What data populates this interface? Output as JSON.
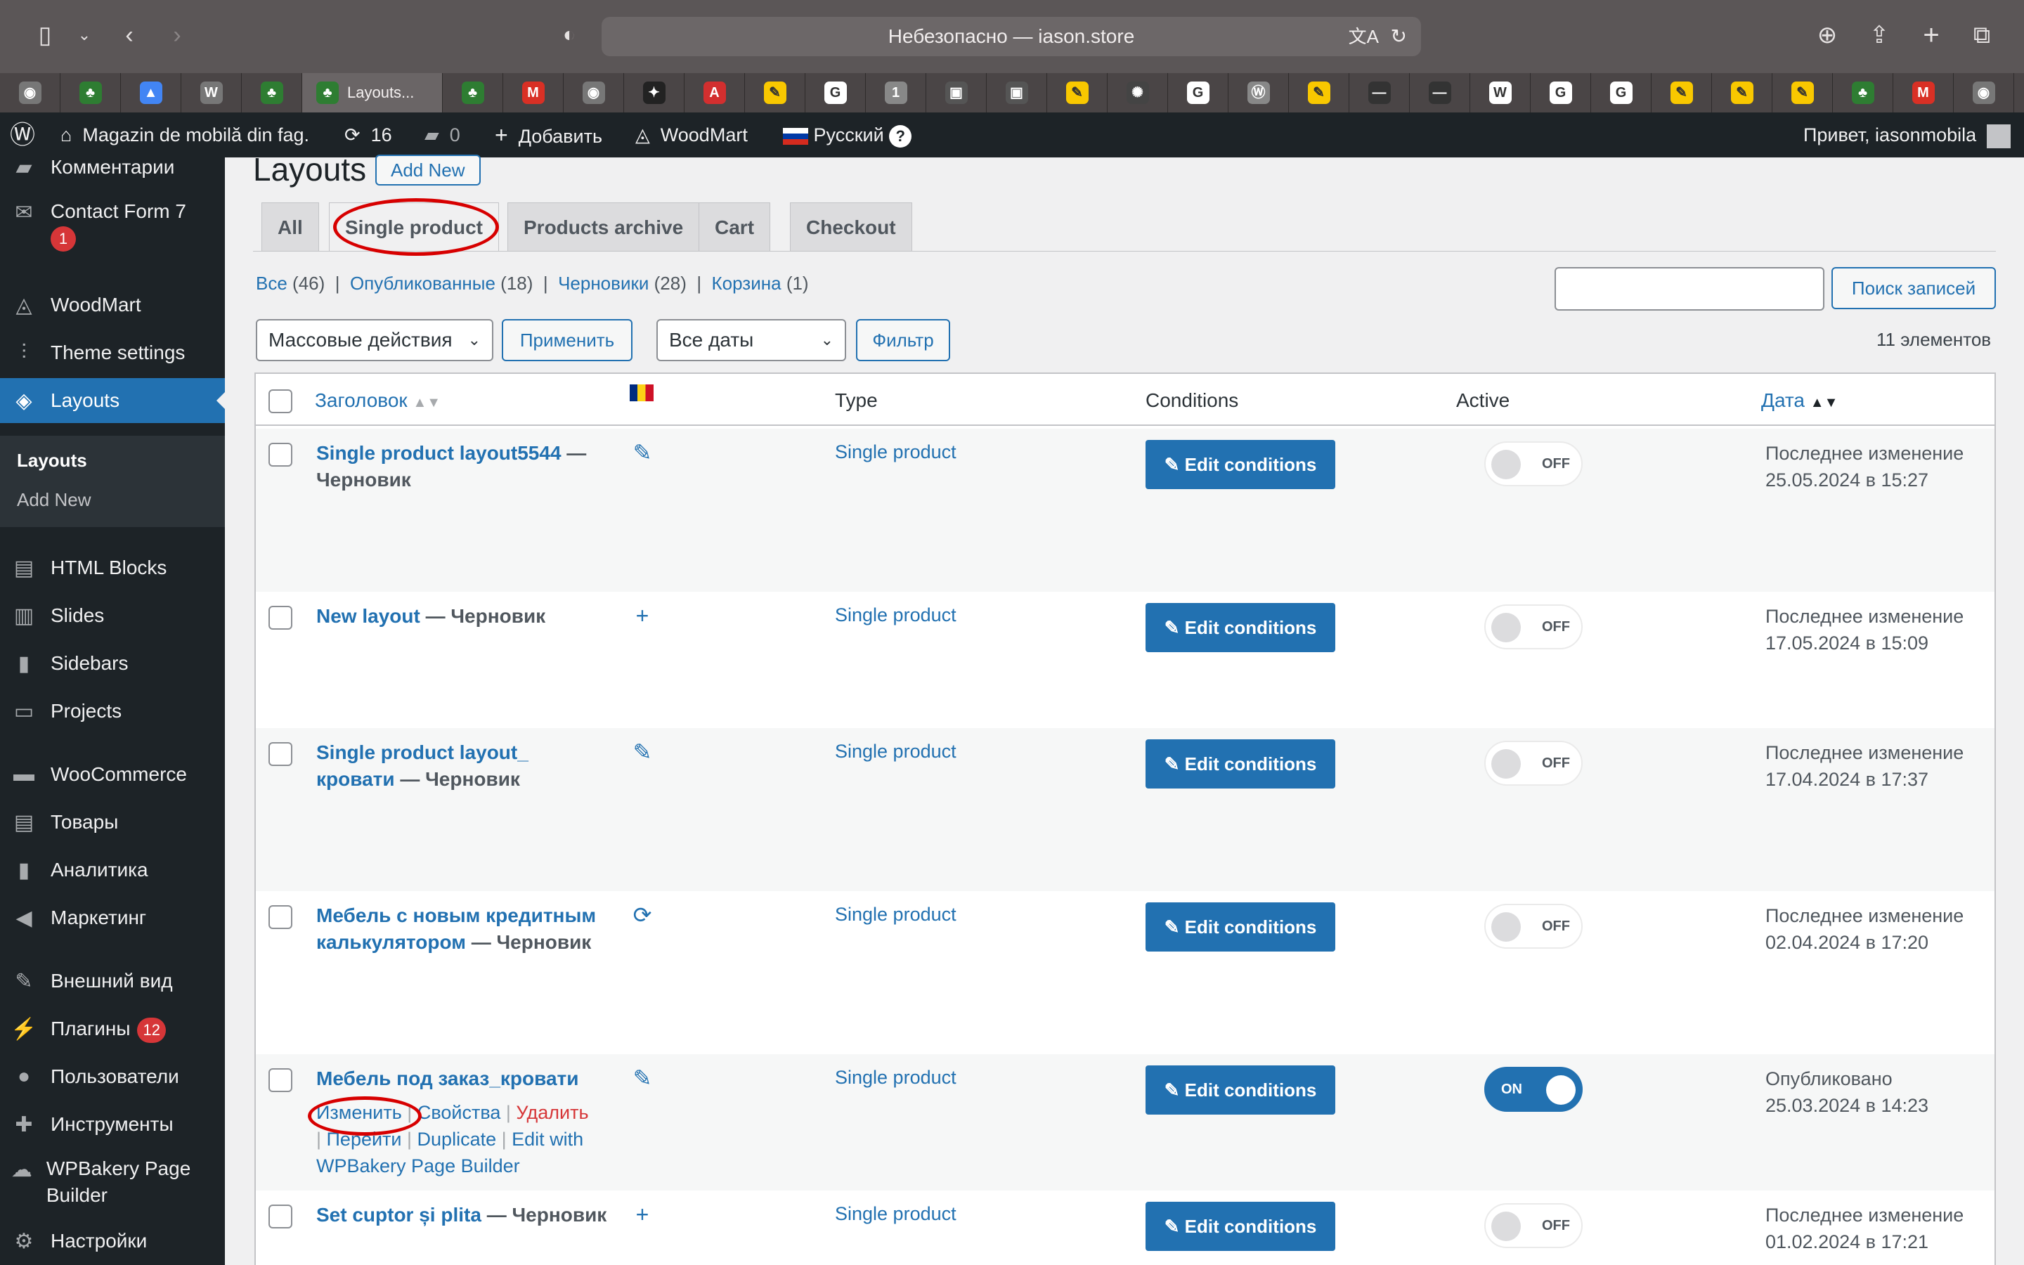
{
  "browser": {
    "address": "Небезопасно — iason.store",
    "active_tab_label": "Layouts...",
    "tab_icons": [
      "reader-icon",
      "wood-logo-icon",
      "drive-icon",
      "wiki-icon",
      "wood-logo-icon",
      "wood-logo-icon",
      "gmail-icon",
      "reader-icon",
      "compass-icon",
      "a-icon",
      "sign-icon",
      "google-icon",
      "one-icon",
      "tv-icon",
      "tv-icon",
      "sign-icon",
      "dots-icon",
      "google-icon",
      "wordpress-icon",
      "sign-icon",
      "line-icon",
      "line-icon",
      "wikipedia-icon",
      "google-icon",
      "google-icon",
      "sign-icon",
      "sign-icon",
      "sign-icon",
      "palm-icon",
      "gmail-icon",
      "reader-icon"
    ]
  },
  "adminbar": {
    "site_name": "Magazin de mobilă din fag.",
    "updates": "16",
    "comments": "0",
    "add": "Добавить",
    "theme": "WoodMart",
    "lang": "Русский",
    "help": "?",
    "greeting": "Привет, iasonmobila"
  },
  "sidebar": {
    "items": [
      {
        "label": "Комментарии",
        "icon": "comment-icon"
      },
      {
        "label": "Contact Form 7",
        "icon": "mail-icon",
        "badge": "1"
      },
      {
        "label": "WoodMart",
        "icon": "woodmart-icon"
      },
      {
        "label": "Theme settings",
        "icon": "settings-sliders-icon"
      },
      {
        "label": "Layouts",
        "icon": "layers-icon"
      },
      {
        "label": "HTML Blocks",
        "icon": "html-icon"
      },
      {
        "label": "Slides",
        "icon": "slides-icon"
      },
      {
        "label": "Sidebars",
        "icon": "sidebar-icon"
      },
      {
        "label": "Projects",
        "icon": "briefcase-icon"
      },
      {
        "label": "WooCommerce",
        "icon": "woo-icon"
      },
      {
        "label": "Товары",
        "icon": "archive-icon"
      },
      {
        "label": "Аналитика",
        "icon": "chart-icon"
      },
      {
        "label": "Маркетинг",
        "icon": "megaphone-icon"
      },
      {
        "label": "Внешний вид",
        "icon": "brush-icon"
      },
      {
        "label": "Плагины",
        "icon": "plugin-icon",
        "badge": "12"
      },
      {
        "label": "Пользователи",
        "icon": "user-icon"
      },
      {
        "label": "Инструменты",
        "icon": "wrench-icon"
      },
      {
        "label": "WPBakery Page Builder",
        "icon": "cloud-icon"
      },
      {
        "label": "Настройки",
        "icon": "settings-icon"
      }
    ],
    "submenu": {
      "current": "Layouts",
      "add_new": "Add New"
    }
  },
  "page": {
    "title": "Layouts",
    "add_new": "Add New",
    "tabs": [
      "All",
      "Single product",
      "Products archive",
      "Cart",
      "Checkout"
    ],
    "filters": {
      "all": "Все",
      "all_count": "(46)",
      "published": "Опубликованные",
      "published_count": "(18)",
      "drafts": "Черновики",
      "drafts_count": "(28)",
      "trash": "Корзина",
      "trash_count": "(1)"
    },
    "search_button": "Поиск записей",
    "bulk_actions": "Массовые действия",
    "apply": "Применить",
    "dates": "Все даты",
    "filter": "Фильтр",
    "count": "11 элементов"
  },
  "table": {
    "headers": {
      "title": "Заголовок",
      "type": "Type",
      "conditions": "Conditions",
      "active": "Active",
      "date": "Дата"
    },
    "rows": [
      {
        "title": "Single product layout5544",
        "state": "— Черновик",
        "icon": "pencil-icon",
        "type": "Single product",
        "conditions": "Edit conditions",
        "active": "OFF",
        "date1": "Последнее изменение",
        "date2": "25.05.2024 в 15:27"
      },
      {
        "title": "New layout",
        "state": "— Черновик",
        "icon": "plus-icon",
        "type": "Single product",
        "conditions": "Edit conditions",
        "active": "OFF",
        "date1": "Последнее изменение",
        "date2": "17.05.2024 в 15:09"
      },
      {
        "title": "Single product layout_ кровати",
        "state": "— Черновик",
        "icon": "pencil-icon",
        "type": "Single product",
        "conditions": "Edit conditions",
        "active": "OFF",
        "date1": "Последнее изменение",
        "date2": "17.04.2024 в 17:37"
      },
      {
        "title": "Мебель с новым кредитным калькулятором",
        "state": "— Черновик",
        "icon": "sync-icon",
        "type": "Single product",
        "conditions": "Edit conditions",
        "active": "OFF",
        "date1": "Последнее изменение",
        "date2": "02.04.2024 в 17:20"
      },
      {
        "title": "Мебель под заказ_кровати",
        "state": "",
        "icon": "pencil-icon",
        "type": "Single product",
        "conditions": "Edit conditions",
        "active": "ON",
        "date1": "Опубликовано",
        "date2": "25.03.2024 в 14:23",
        "actions": {
          "edit": "Изменить",
          "props": "Свойства",
          "delete": "Удалить",
          "view": "Перейти",
          "duplicate": "Duplicate",
          "wpbakery": "Edit with WPBakery Page Builder"
        }
      },
      {
        "title": "Set cuptor și plita",
        "state": "— Черновик",
        "icon": "plus-icon",
        "type": "Single product",
        "conditions": "Edit conditions",
        "active": "OFF",
        "date1": "Последнее изменение",
        "date2": "01.02.2024 в 17:21"
      }
    ]
  },
  "colors": {
    "accent": "#2271b1",
    "admin_bg": "#1d2327",
    "annotation": "#d70000"
  }
}
